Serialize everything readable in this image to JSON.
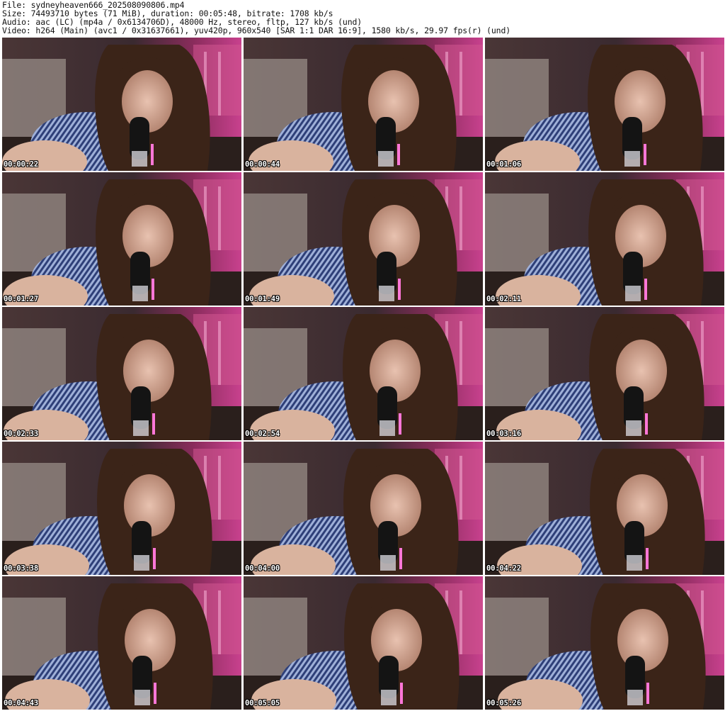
{
  "header": {
    "file": "File: sydneyheaven666_202508090806.mp4",
    "size": "Size: 74493710 bytes (71 MiB), duration: 00:05:48, bitrate: 1708 kb/s",
    "audio": "Audio: aac (LC) (mp4a / 0x6134706D), 48000 Hz, stereo, fltp, 127 kb/s (und)",
    "video": "Video: h264 (Main) (avc1 / 0x31637661), yuv420p, 960x540 [SAR 1:1 DAR 16:9], 1580 kb/s, 29.97 fps(r) (und)"
  },
  "thumbnails": [
    {
      "timestamp": "00:00:22"
    },
    {
      "timestamp": "00:00:44"
    },
    {
      "timestamp": "00:01:06"
    },
    {
      "timestamp": "00:01:27"
    },
    {
      "timestamp": "00:01:49"
    },
    {
      "timestamp": "00:02:11"
    },
    {
      "timestamp": "00:02:33"
    },
    {
      "timestamp": "00:02:54"
    },
    {
      "timestamp": "00:03:16"
    },
    {
      "timestamp": "00:03:38"
    },
    {
      "timestamp": "00:04:00"
    },
    {
      "timestamp": "00:04:22"
    },
    {
      "timestamp": "00:04:43"
    },
    {
      "timestamp": "00:05:05"
    },
    {
      "timestamp": "00:05:26"
    }
  ]
}
